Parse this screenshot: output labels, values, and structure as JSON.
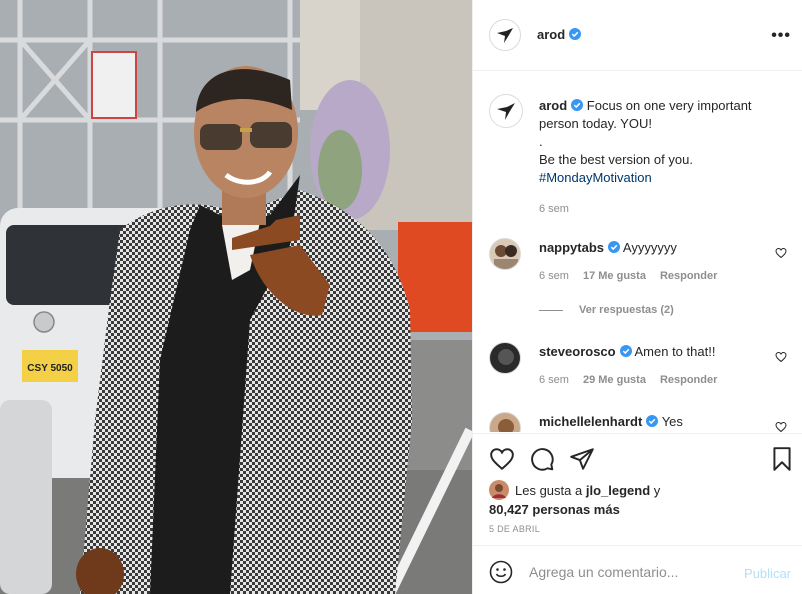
{
  "post": {
    "username": "arod",
    "more_label": "•••"
  },
  "photo": {
    "plate_text": "CSY 5050"
  },
  "caption": {
    "username": "arod",
    "lines": [
      "Focus on one very important",
      "person today. YOU!",
      ".",
      "Be the best version of you."
    ],
    "hashtag": "#MondayMotivation",
    "time": "6 sem"
  },
  "comments": [
    {
      "username": "nappytabs",
      "text": "Ayyyyyyy",
      "time": "6 sem",
      "likes": "17 Me gusta",
      "reply": "Responder"
    },
    {
      "username": "steveorosco",
      "text": "Amen to that!!",
      "time": "6 sem",
      "likes": "29 Me gusta",
      "reply": "Responder"
    },
    {
      "username": "michellelenhardt",
      "text": "Yes"
    }
  ],
  "view_replies": "Ver respuestas (2)",
  "likes": {
    "prefix": "Les gusta a",
    "user": "jlo_legend",
    "conj": "y",
    "count": "80,427 personas más"
  },
  "date": "5 DE ABRIL",
  "add_comment": {
    "placeholder": "Agrega un comentario...",
    "publish": "Publicar"
  },
  "colors": {
    "verified": "#3897f0",
    "hashtag": "#00376b",
    "publish_disabled": "#b2dffc"
  }
}
